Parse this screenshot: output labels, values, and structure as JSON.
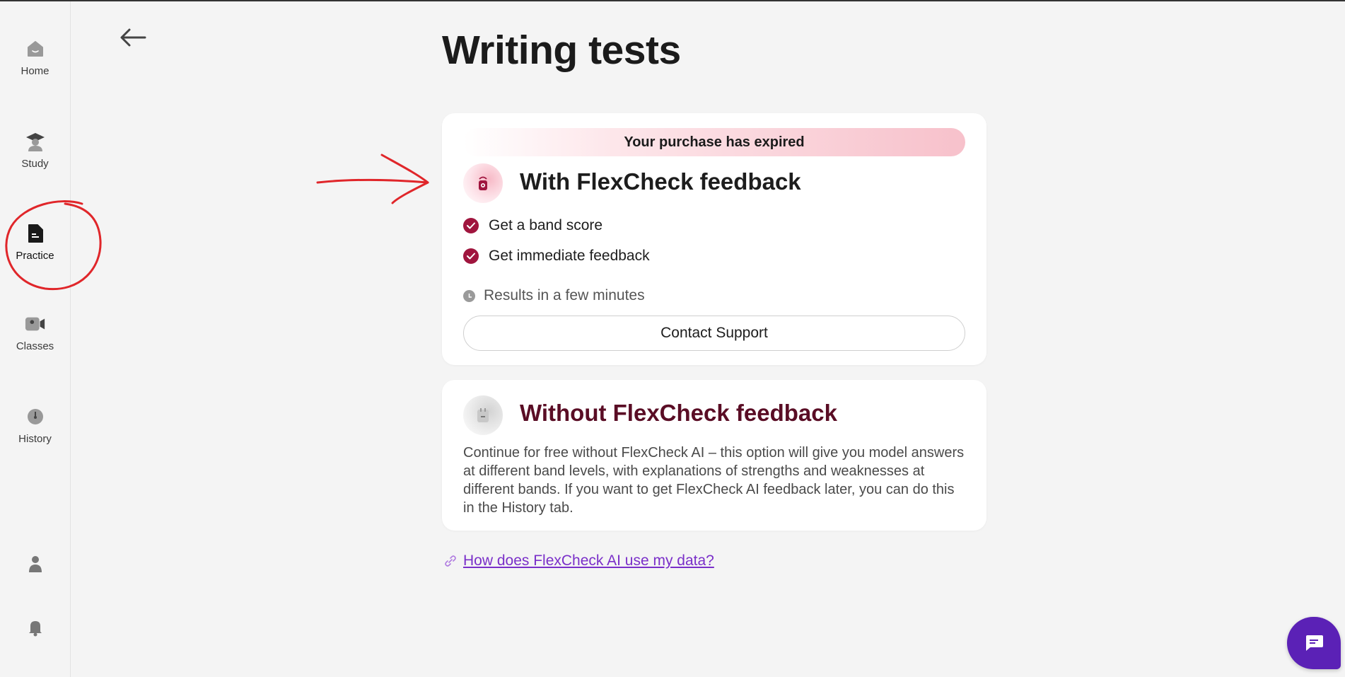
{
  "sidebar": {
    "items": [
      {
        "label": "Home",
        "icon": "home-icon"
      },
      {
        "label": "Study",
        "icon": "graduate-icon"
      },
      {
        "label": "Practice",
        "icon": "document-icon",
        "active": true
      },
      {
        "label": "Classes",
        "icon": "video-camera-icon"
      },
      {
        "label": "History",
        "icon": "clock-icon"
      }
    ],
    "bottom_icons": [
      "user-icon",
      "bell-icon"
    ]
  },
  "header": {
    "back_icon": "arrow-left-icon",
    "title": "Writing tests"
  },
  "option_with": {
    "banner": "Your purchase has expired",
    "title": "With FlexCheck feedback",
    "features": [
      "Get a band score",
      "Get immediate feedback"
    ],
    "results": "Results in a few minutes",
    "button_label": "Contact Support"
  },
  "option_without": {
    "title": "Without FlexCheck feedback",
    "description": "Continue for free without FlexCheck AI – this option will give you model answers at different band levels, with explanations of strengths and weaknesses at different bands. If you want to get FlexCheck AI feedback later, you can do this in the History tab."
  },
  "data_link": {
    "label": "How does FlexCheck AI use my data?",
    "icon": "link-icon"
  },
  "chat": {
    "icon": "chat-bubble-icon"
  },
  "colors": {
    "accent": "#a0153e",
    "heading_dark": "#5a0d25",
    "link": "#7a2fc9",
    "chat": "#5b21b6",
    "annotation": "#e0262a"
  }
}
